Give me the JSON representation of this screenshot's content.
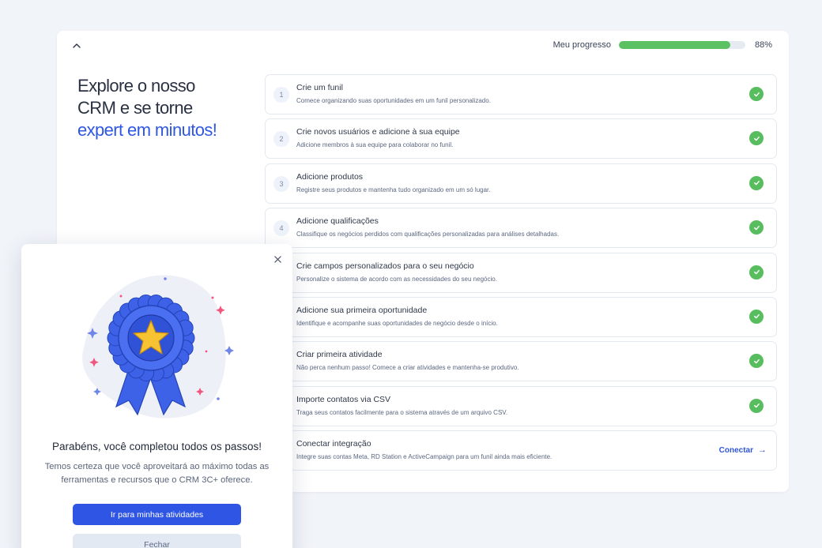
{
  "progress": {
    "label": "Meu progresso",
    "value": 0.88,
    "percent_text": "88%"
  },
  "hero": {
    "line1": "Explore o nosso",
    "line2": "CRM e se torne",
    "accent": "expert em minutos!"
  },
  "steps": [
    {
      "number": "1",
      "title": "Crie um funil",
      "description": "Comece organizando suas oportunidades em um funil personalizado.",
      "done": true
    },
    {
      "number": "2",
      "title": "Crie novos usuários e adicione à sua equipe",
      "description": "Adicione membros à sua equipe para colaborar no funil.",
      "done": true
    },
    {
      "number": "3",
      "title": "Adicione produtos",
      "description": "Registre seus produtos e mantenha tudo organizado em um só lugar.",
      "done": true
    },
    {
      "number": "4",
      "title": "Adicione qualificações",
      "description": "Classifique os negócios perdidos com qualificações personalizadas para análises detalhadas.",
      "done": true
    },
    {
      "number": "",
      "title": "Crie campos personalizados para o seu negócio",
      "description": "Personalize o sistema de acordo com as necessidades do seu negócio.",
      "done": true
    },
    {
      "number": "",
      "title": "Adicione sua primeira oportunidade",
      "description": "Identifique e acompanhe suas oportunidades de negócio desde o início.",
      "done": true
    },
    {
      "number": "",
      "title": "Criar primeira atividade",
      "description": "Não perca nenhum passo! Comece a criar atividades e mantenha-se produtivo.",
      "done": true
    },
    {
      "number": "",
      "title": "Importe contatos via CSV",
      "description": "Traga seus contatos facilmente para o sistema através de um arquivo CSV.",
      "done": true
    },
    {
      "number": "",
      "title": "Conectar integração",
      "description": "Integre suas contas Meta, RD Station e ActiveCampaign para um funil ainda mais eficiente.",
      "done": false,
      "action": "Conectar",
      "action_icon": "arrow-right-icon"
    }
  ],
  "modal": {
    "title": "Parabéns, você completou todos os passos!",
    "text": "Temos certeza que você aproveitará ao máximo todas as ferramentas e recursos que o CRM 3C+ oferece.",
    "primary_button": "Ir para minhas atividades",
    "secondary_button": "Fechar",
    "illustration": "award-rosette-icon"
  },
  "colors": {
    "accent": "#2e55e3",
    "success": "#57bd5f",
    "progress_fill": "#5bc162"
  }
}
